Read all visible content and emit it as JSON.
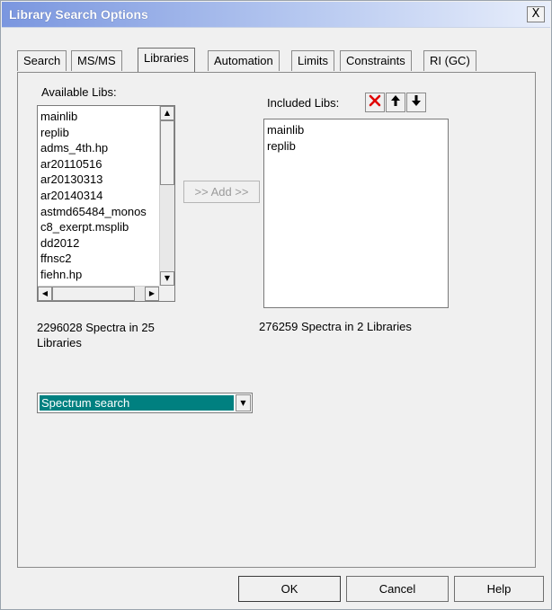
{
  "window": {
    "title": "Library Search Options",
    "close_label": "X"
  },
  "tabs": [
    {
      "label": "Search"
    },
    {
      "label": "MS/MS"
    },
    {
      "label": "Libraries",
      "active": true
    },
    {
      "label": "Automation"
    },
    {
      "label": "Limits"
    },
    {
      "label": "Constraints"
    },
    {
      "label": "RI (GC)"
    }
  ],
  "available": {
    "label": "Available Libs:",
    "items": [
      "mainlib",
      "replib",
      "adms_4th.hp",
      "ar20110516",
      "ar20130313",
      "ar20140314",
      "astmd65484_monos",
      "c8_exerpt.msplib",
      "dd2012",
      "ffnsc2",
      "fiehn.hp"
    ],
    "summary": "2296028 Spectra in 25 Libraries"
  },
  "add_button": ">> Add >>",
  "included": {
    "label": "Included Libs:",
    "items": [
      "mainlib",
      "replib"
    ],
    "summary": "276259 Spectra in 2 Libraries",
    "toolbar": {
      "delete_icon": "red-x-icon",
      "up_icon": "arrow-up-icon",
      "down_icon": "arrow-down-icon"
    }
  },
  "search_type": {
    "value": "Spectrum search"
  },
  "buttons": {
    "ok": "OK",
    "cancel": "Cancel",
    "help": "Help"
  },
  "colors": {
    "selection": "#008080",
    "delete_icon": "#e00000"
  }
}
